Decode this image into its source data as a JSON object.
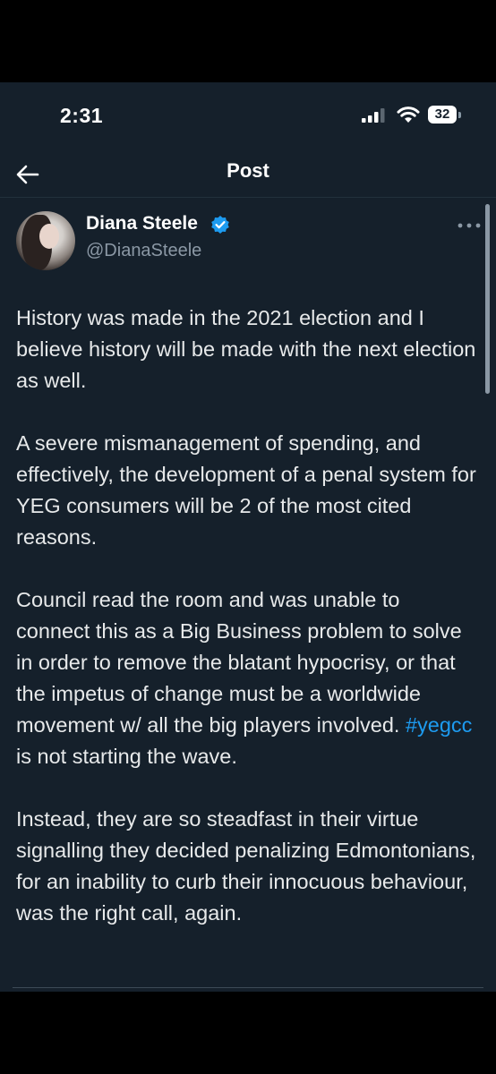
{
  "status_bar": {
    "time": "2:31",
    "battery_level": "32"
  },
  "header": {
    "title": "Post"
  },
  "author": {
    "name": "Diana Steele",
    "handle": "@DianaSteele",
    "verified": true
  },
  "post": {
    "paragraph_1": "History was made in the 2021 election and I believe history will be made with the next election as well.",
    "paragraph_2": "A severe mismanagement of spending, and effectively, the development of a penal system for YEG consumers will be 2 of the most cited reasons.",
    "paragraph_3_before": "Council read the room and was unable to connect this as a Big Business problem to solve in order to remove the blatant hypocrisy, or that the impetus of change must be a worldwide movement w/ all the big players involved. ",
    "paragraph_3_hashtag": "#yegcc",
    "paragraph_3_after": "  is not starting the wave.",
    "paragraph_4": "Instead, they are so steadfast in their virtue signalling they decided penalizing Edmontonians, for an inability to curb their innocuous behaviour, was the right call, again."
  },
  "colors": {
    "background": "#15202b",
    "text": "#e7e9ea",
    "secondary_text": "#8b98a5",
    "accent": "#1d9bf0"
  }
}
